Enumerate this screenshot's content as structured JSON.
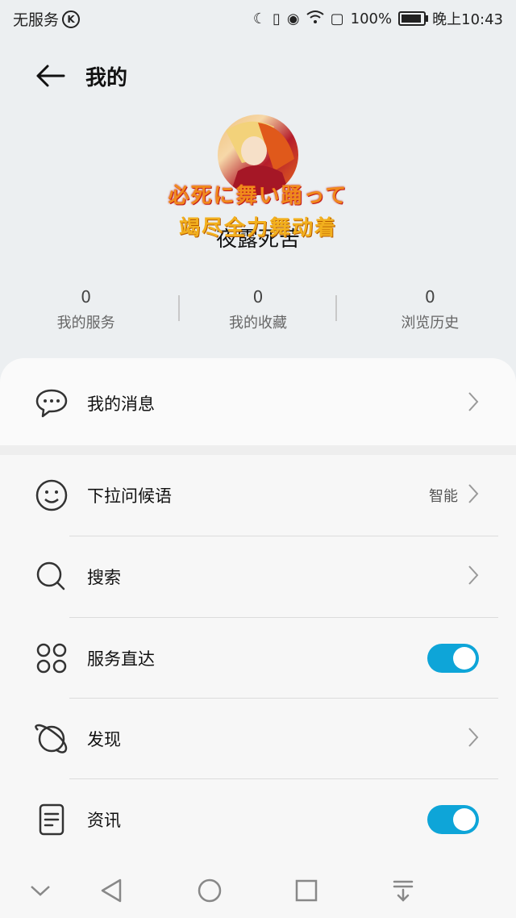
{
  "status_bar": {
    "carrier": "无服务",
    "battery": "100%",
    "time": "晚上10:43"
  },
  "header": {
    "title": "我的"
  },
  "profile": {
    "overlay_line1": "必死に舞い踊って",
    "overlay_line2": "竭尽全力舞动着",
    "username": "夜露死苦"
  },
  "stats": [
    {
      "count": "0",
      "label": "我的服务"
    },
    {
      "count": "0",
      "label": "我的收藏"
    },
    {
      "count": "0",
      "label": "浏览历史"
    }
  ],
  "menu": {
    "messages": {
      "label": "我的消息"
    },
    "greeting": {
      "label": "下拉问候语",
      "value": "智能"
    },
    "search": {
      "label": "搜索"
    },
    "service_direct": {
      "label": "服务直达",
      "enabled": true
    },
    "discover": {
      "label": "发现"
    },
    "news": {
      "label": "资讯",
      "enabled": true
    }
  },
  "colors": {
    "toggle_on": "#0ea5d8",
    "top_background": "#eceff1"
  }
}
